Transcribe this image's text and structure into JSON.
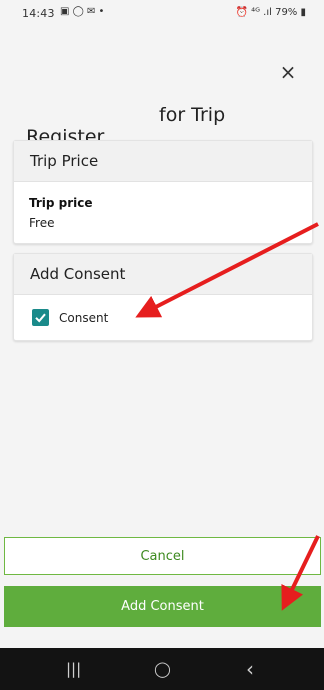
{
  "status_bar": {
    "time": "14:43",
    "left_icons": "▣ ◯ ✉ •",
    "right_text": "⏰ ⁴ᴳ .ıl 79% ▮"
  },
  "dialog": {
    "close_icon": "×",
    "title_part1": "Register",
    "title_part2": "for Trip"
  },
  "trip_price_card": {
    "header": "Trip Price",
    "field_label": "Trip price",
    "field_value": "Free"
  },
  "consent_card": {
    "header": "Add Consent",
    "checkbox_label": "Consent",
    "checked": true
  },
  "buttons": {
    "cancel": "Cancel",
    "add_consent": "Add Consent"
  },
  "nav_bar": {
    "recent": "|||",
    "home": "◯",
    "back": "‹"
  },
  "colors": {
    "accent_green": "#5fad3d",
    "checkbox_teal": "#1a8a8a",
    "annotation_arrow": "#e61e1e"
  }
}
